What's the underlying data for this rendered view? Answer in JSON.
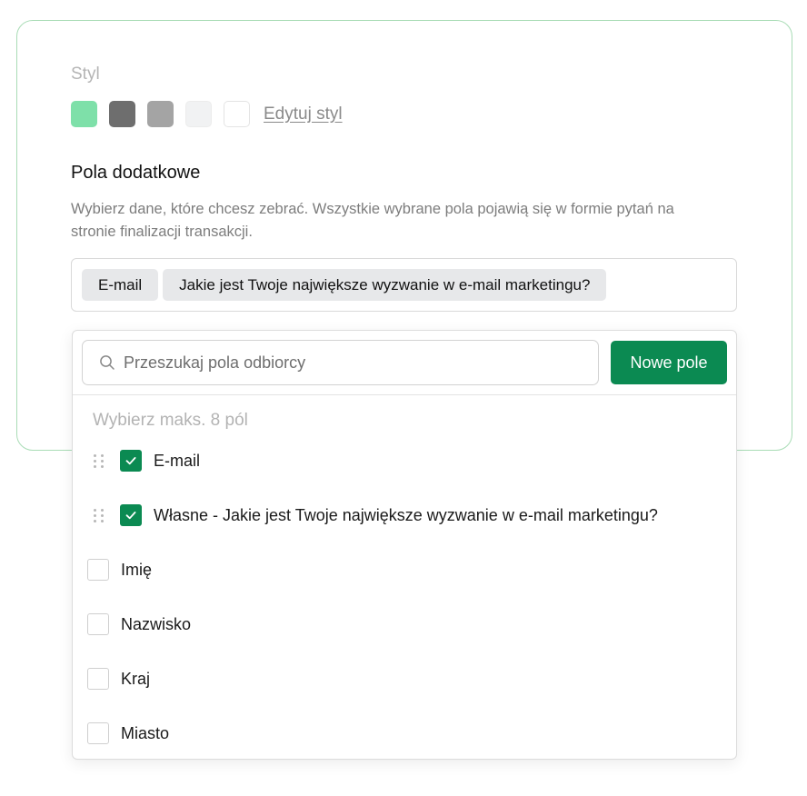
{
  "style_section": {
    "label": "Styl",
    "swatches": [
      {
        "name": "green",
        "color": "#7ee0a9"
      },
      {
        "name": "dark-gray",
        "color": "#6e6e6e"
      },
      {
        "name": "gray",
        "color": "#a4a4a4"
      },
      {
        "name": "light-gray",
        "color": "#f1f2f3"
      },
      {
        "name": "white",
        "color": "#ffffff"
      }
    ],
    "edit_link": "Edytuj styl"
  },
  "additional_fields": {
    "title": "Pola dodatkowe",
    "description": "Wybierz dane, które chcesz zebrać. Wszystkie wybrane pola pojawią się w formie pytań na stronie finalizacji transakcji.",
    "chips": [
      "E-mail",
      "Jakie jest Twoje największe wyzwanie w e-mail marketingu?"
    ]
  },
  "dropdown": {
    "search_placeholder": "Przeszukaj pola odbiorcy",
    "new_field_button": "Nowe pole",
    "hint": "Wybierz maks. 8 pól",
    "items": [
      {
        "label": "E-mail",
        "checked": true,
        "draggable": true
      },
      {
        "label": "Własne - Jakie jest Twoje największe wyzwanie w e-mail marketingu?",
        "checked": true,
        "draggable": true
      },
      {
        "label": "Imię",
        "checked": false,
        "draggable": false
      },
      {
        "label": "Nazwisko",
        "checked": false,
        "draggable": false
      },
      {
        "label": "Kraj",
        "checked": false,
        "draggable": false
      },
      {
        "label": "Miasto",
        "checked": false,
        "draggable": false
      }
    ]
  },
  "colors": {
    "accent": "#0b8a52",
    "card_border": "#a9dcb6"
  }
}
